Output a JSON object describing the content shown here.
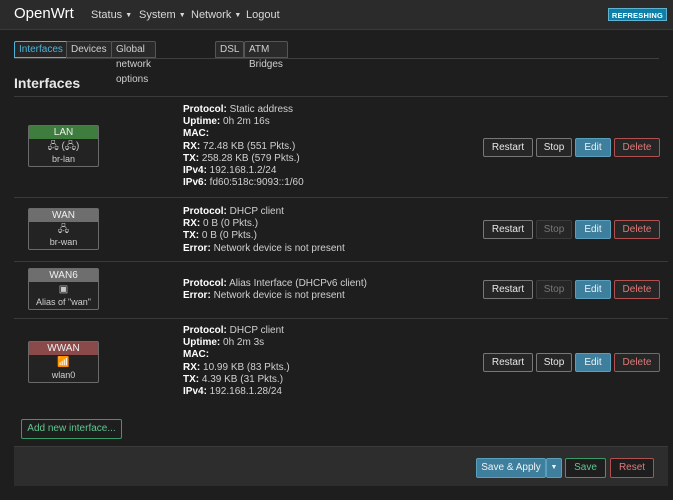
{
  "app": {
    "brand": "OpenWrt",
    "status_badge": "REFRESHING"
  },
  "nav": {
    "status": "Status",
    "system": "System",
    "network": "Network",
    "logout": "Logout",
    "caret": "▼"
  },
  "tabs": [
    "Interfaces",
    "Devices",
    "Global network options",
    "DSL",
    "ATM Bridges"
  ],
  "section_title": "Interfaces",
  "interfaces": [
    {
      "name": "LAN",
      "color": "#3f7d3f",
      "icons": "🖧 (🖧)",
      "device": "br-lan",
      "lines": [
        {
          "k": "Protocol:",
          "v": " Static address"
        },
        {
          "k": "Uptime:",
          "v": " 0h 2m 16s"
        },
        {
          "k": "MAC:",
          "v": ""
        },
        {
          "k": "RX:",
          "v": " 72.48 KB (551 Pkts.)"
        },
        {
          "k": "TX:",
          "v": " 258.28 KB (579 Pkts.)"
        },
        {
          "k": "IPv4:",
          "v": " 192.168.1.2/24"
        },
        {
          "k": "IPv6:",
          "v": " fd60:518c:9093::1/60"
        }
      ]
    },
    {
      "name": "WAN",
      "color": "#6e6e6e",
      "icons": "🖧",
      "device": "br-wan",
      "lines": [
        {
          "k": "Protocol:",
          "v": " DHCP client"
        },
        {
          "k": "RX:",
          "v": " 0 B (0 Pkts.)"
        },
        {
          "k": "TX:",
          "v": " 0 B (0 Pkts.)"
        },
        {
          "k": "Error:",
          "v": " Network device is not present"
        }
      ]
    },
    {
      "name": "WAN6",
      "color": "#6e6e6e",
      "icons": "▣",
      "device": "Alias of \"wan\"",
      "lines": [
        {
          "k": "Protocol:",
          "v": " Alias Interface (DHCPv6 client)"
        },
        {
          "k": "Error:",
          "v": " Network device is not present"
        }
      ]
    },
    {
      "name": "WWAN",
      "color": "#8a4a4a",
      "icons": "📶",
      "device": "wlan0",
      "lines": [
        {
          "k": "Protocol:",
          "v": " DHCP client"
        },
        {
          "k": "Uptime:",
          "v": " 0h 2m 3s"
        },
        {
          "k": "MAC:",
          "v": ""
        },
        {
          "k": "RX:",
          "v": " 10.99 KB (83 Pkts.)"
        },
        {
          "k": "TX:",
          "v": " 4.39 KB (31 Pkts.)"
        },
        {
          "k": "IPv4:",
          "v": " 192.168.1.28/24"
        }
      ]
    }
  ],
  "row_buttons": {
    "restart": "Restart",
    "stop": "Stop",
    "edit": "Edit",
    "delete": "Delete"
  },
  "add_interface": "Add new interface...",
  "footer": {
    "save_apply": "Save & Apply",
    "dropdown_caret": "▼",
    "save": "Save",
    "reset": "Reset"
  }
}
